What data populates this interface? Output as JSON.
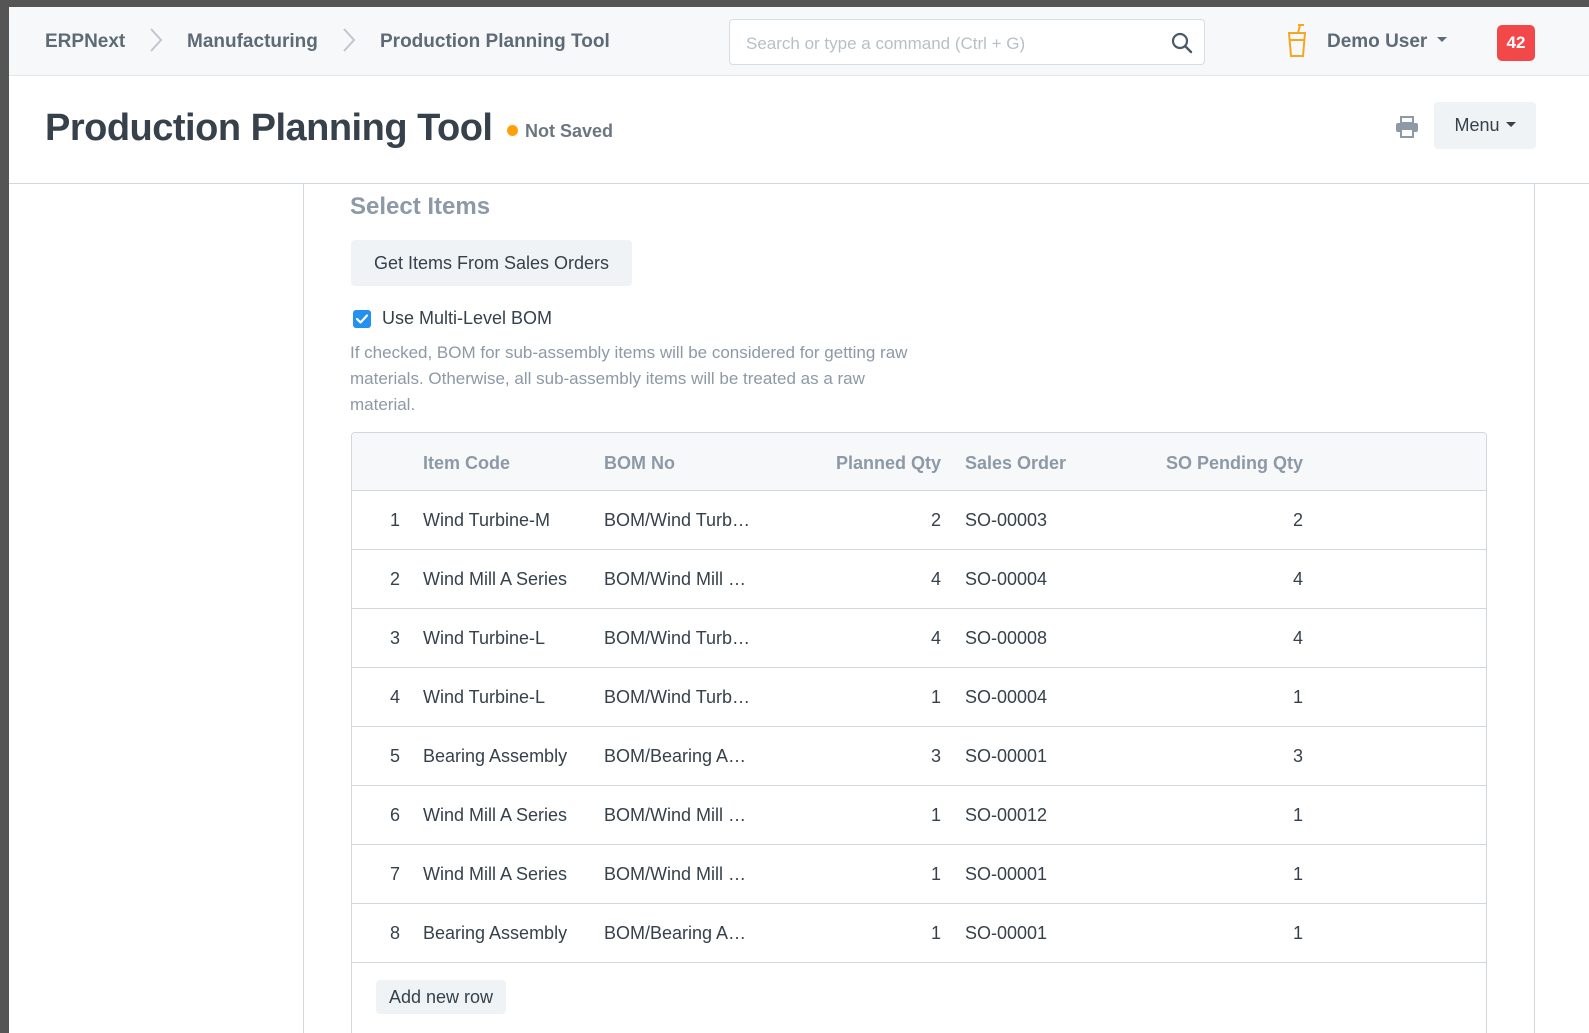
{
  "breadcrumbs": [
    "ERPNext",
    "Manufacturing",
    "Production Planning Tool"
  ],
  "search": {
    "placeholder": "Search or type a command (Ctrl + G)"
  },
  "user": {
    "name": "Demo User",
    "notification_count": "42"
  },
  "page": {
    "title": "Production Planning Tool",
    "status": "Not Saved",
    "menu_label": "Menu"
  },
  "section": {
    "title": "Select Items",
    "get_items_button": "Get Items From Sales Orders",
    "multi_level_bom": {
      "label": "Use Multi-Level BOM",
      "checked": true,
      "help": "If checked, BOM for sub-assembly items will be considered for getting raw materials. Otherwise, all sub-assembly items will be treated as a raw material."
    }
  },
  "grid": {
    "columns": [
      "Item Code",
      "BOM No",
      "Planned Qty",
      "Sales Order",
      "SO Pending Qty"
    ],
    "rows": [
      [
        "1",
        "Wind Turbine-M",
        "BOM/Wind Turb…",
        "2",
        "SO-00003",
        "2"
      ],
      [
        "2",
        "Wind Mill A Series",
        "BOM/Wind Mill …",
        "4",
        "SO-00004",
        "4"
      ],
      [
        "3",
        "Wind Turbine-L",
        "BOM/Wind Turb…",
        "4",
        "SO-00008",
        "4"
      ],
      [
        "4",
        "Wind Turbine-L",
        "BOM/Wind Turb…",
        "1",
        "SO-00004",
        "1"
      ],
      [
        "5",
        "Bearing Assembly",
        "BOM/Bearing A…",
        "3",
        "SO-00001",
        "3"
      ],
      [
        "6",
        "Wind Mill A Series",
        "BOM/Wind Mill …",
        "1",
        "SO-00012",
        "1"
      ],
      [
        "7",
        "Wind Mill A Series",
        "BOM/Wind Mill …",
        "1",
        "SO-00001",
        "1"
      ],
      [
        "8",
        "Bearing Assembly",
        "BOM/Bearing A…",
        "1",
        "SO-00001",
        "1"
      ]
    ],
    "add_row_label": "Add new row"
  },
  "icons": [
    "chevron-right-icon",
    "search-icon",
    "cup-icon",
    "caret-down-icon",
    "printer-icon",
    "checkbox-checked-icon"
  ],
  "colors": {
    "accent": "#2490ef",
    "status_dot": "#ffa00a",
    "notification": "#f3484a"
  }
}
